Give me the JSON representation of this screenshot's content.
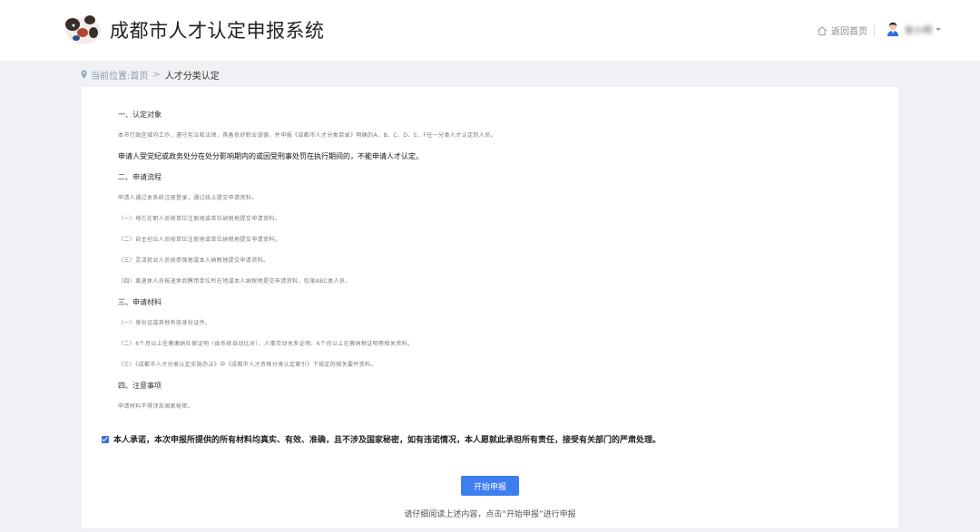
{
  "header": {
    "title": "成都市人才认定申报系统",
    "home_label": "返回首页",
    "user_name": "张小明",
    "icons": {
      "logo": "panda-logo",
      "home": "home-icon",
      "avatar": "avatar-icon",
      "dropdown": "caret-down-icon"
    }
  },
  "breadcrumb": {
    "prefix": "当前位置:",
    "home": "首页",
    "separator": ">",
    "current": "人才分类认定"
  },
  "notice": {
    "section1_title": "一、认定对象",
    "section1_p1": "本市行政区域内工作，遵守宪法和法律，具备良好职业道德，并申报《成都市人才分类目录》明确的A、B、C、D、E、F任一分类人才认定的人员。",
    "section1_p2": "申请人受党纪或政务处分在处分影响期内的或因受刑事处罚在执行期间的，不能申请人才认定。",
    "section2_title": "二、申请流程",
    "section2_p1": "申请人通过本系统注册登录，通过线上提交申请资料。",
    "section2_p2": "（一）地方在职人员按单位注册地或单位纳税地提交申请资料。",
    "section2_p3": "（二）自主创业人员按单位注册地或单位纳税地提交申请资料。",
    "section2_p4": "（三）灵活就业人员按参保地或本人纳税地提交申请资料。",
    "section2_p5": "（四）离退休人员按退休后聘用单位所在地或本人纳税地提交申请资料，仅限ABC类人员。",
    "section3_title": "三、申请材料",
    "section3_p1": "（一）身份证或其他有效身份证件。",
    "section3_p2": "（二）6个月以上在蓉缴纳社保证明（由系统自动比对）、人事劳动关系证明、6个月以上在蓉纳税证明等相关资料。",
    "section3_p3": "（三）《成都市人才分类认定实施办法》中《成都市人才资格分类认定索引》下规定的相关要件资料。",
    "section4_title": "四、注意事项",
    "section4_p1": "申请材料不得涉及国家秘密。"
  },
  "promise": {
    "checked": true,
    "text": "本人承诺，本次申报所提供的所有材料均真实、有效、准确，且不涉及国家秘密，如有违诺情况，本人愿就此承担所有责任，接受有关部门的严肃处理。"
  },
  "actions": {
    "start_label": "开始申报",
    "hint": "请仔细阅读上述内容，点击“开始申报”进行申报"
  },
  "colors": {
    "primary": "#3d7ef0",
    "background": "#f0f1f4",
    "checkbox": "#3f6ed6"
  }
}
